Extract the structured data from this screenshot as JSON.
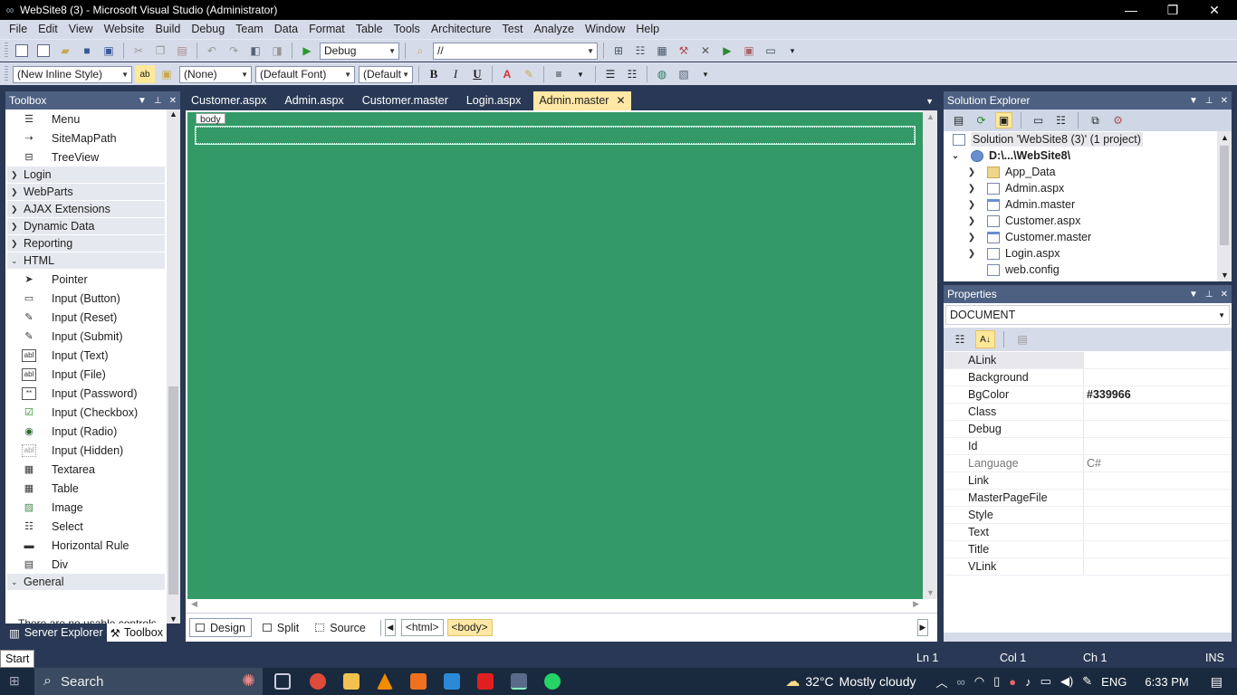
{
  "window": {
    "title": "WebSite8 (3) - Microsoft Visual Studio (Administrator)"
  },
  "menu": [
    "File",
    "Edit",
    "View",
    "Website",
    "Build",
    "Debug",
    "Team",
    "Data",
    "Format",
    "Table",
    "Tools",
    "Architecture",
    "Test",
    "Analyze",
    "Window",
    "Help"
  ],
  "toolbar1": {
    "config": "Debug",
    "find": "//"
  },
  "toolbar2": {
    "style": "(New Inline Style)",
    "block": "(None)",
    "font": "(Default Font)",
    "size": "(Default",
    "bold": "B",
    "italic": "I",
    "underline": "U"
  },
  "toolbox": {
    "title": "Toolbox",
    "top_items": [
      "Menu",
      "SiteMapPath",
      "TreeView"
    ],
    "categories_collapsed": [
      "Login",
      "WebParts",
      "AJAX Extensions",
      "Dynamic Data",
      "Reporting"
    ],
    "html_category": "HTML",
    "html_items": [
      "Pointer",
      "Input (Button)",
      "Input (Reset)",
      "Input (Submit)",
      "Input (Text)",
      "Input (File)",
      "Input (Password)",
      "Input (Checkbox)",
      "Input (Radio)",
      "Input (Hidden)",
      "Textarea",
      "Table",
      "Image",
      "Select",
      "Horizontal Rule",
      "Div"
    ],
    "general_category": "General",
    "empty_message": "There are no usable controls",
    "bottom_tabs": [
      "Server Explorer",
      "Toolbox"
    ]
  },
  "doc_tabs": [
    "Customer.aspx",
    "Admin.aspx",
    "Customer.master",
    "Login.aspx",
    "Admin.master"
  ],
  "design": {
    "bgcolor": "#339966",
    "body_tag": "body",
    "views": [
      "Design",
      "Split",
      "Source"
    ],
    "breadcrumbs": [
      "<html>",
      "<body>"
    ]
  },
  "solution_explorer": {
    "title": "Solution Explorer",
    "solution": "Solution 'WebSite8 (3)' (1 project)",
    "project": "D:\\...\\WebSite8\\",
    "items": [
      "App_Data",
      "Admin.aspx",
      "Admin.master",
      "Customer.aspx",
      "Customer.master",
      "Login.aspx",
      "web.config"
    ]
  },
  "properties": {
    "title": "Properties",
    "object": "DOCUMENT",
    "rows": [
      {
        "name": "ALink",
        "value": ""
      },
      {
        "name": "Background",
        "value": ""
      },
      {
        "name": "BgColor",
        "value": "#339966"
      },
      {
        "name": "Class",
        "value": ""
      },
      {
        "name": "Debug",
        "value": ""
      },
      {
        "name": "Id",
        "value": ""
      },
      {
        "name": "Language",
        "value": "C#"
      },
      {
        "name": "Link",
        "value": ""
      },
      {
        "name": "MasterPageFile",
        "value": ""
      },
      {
        "name": "Style",
        "value": ""
      },
      {
        "name": "Text",
        "value": ""
      },
      {
        "name": "Title",
        "value": ""
      },
      {
        "name": "VLink",
        "value": ""
      }
    ]
  },
  "status": {
    "start": "Start",
    "ln": "Ln 1",
    "col": "Col 1",
    "ch": "Ch 1",
    "mode": "INS"
  },
  "taskbar": {
    "search": "Search",
    "temp": "32°C",
    "weather": "Mostly cloudy",
    "lang": "ENG",
    "time": "6:33 PM"
  }
}
